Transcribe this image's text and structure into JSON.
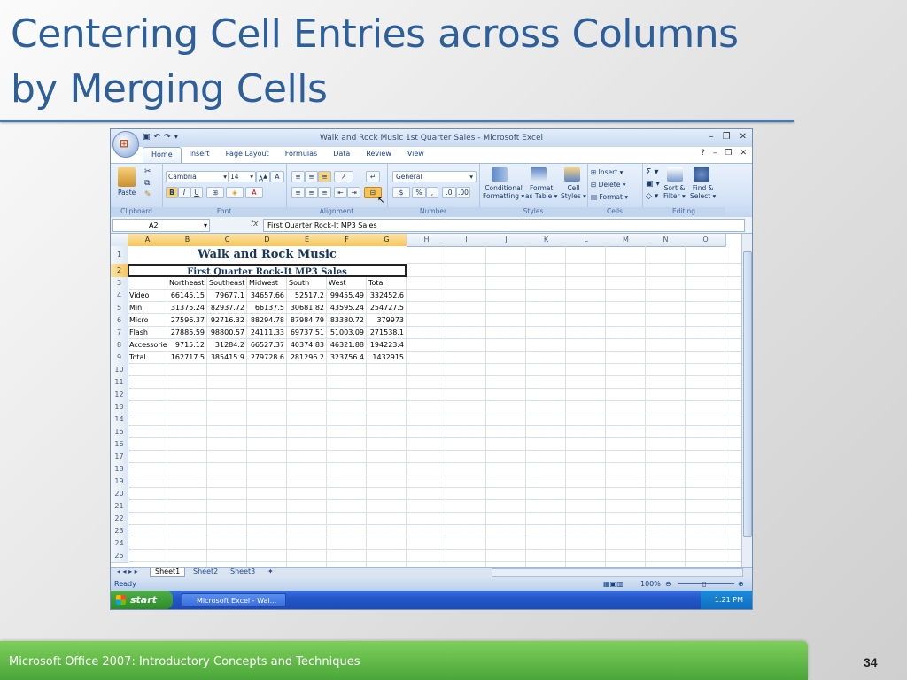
{
  "slide": {
    "title_line1": "Centering Cell Entries across Columns",
    "title_line2": "by Merging Cells",
    "footer_text": "Microsoft Office 2007: Introductory Concepts and Techniques",
    "page_number": "34"
  },
  "excel": {
    "window_title": "Walk and Rock Music 1st Quarter Sales - Microsoft Excel",
    "tabs": [
      "Home",
      "Insert",
      "Page Layout",
      "Formulas",
      "Data",
      "Review",
      "View"
    ],
    "ribbon": {
      "clipboard": {
        "label": "Clipboard",
        "paste": "Paste"
      },
      "font": {
        "label": "Font",
        "family": "Cambria",
        "size": "14"
      },
      "alignment": {
        "label": "Alignment"
      },
      "number": {
        "label": "Number",
        "format": "General",
        "currency": "$",
        "percent": "%",
        "comma": ","
      },
      "styles": {
        "label": "Styles",
        "conditional1": "Conditional",
        "conditional2": "Formatting",
        "format_table1": "Format",
        "format_table2": "as Table",
        "cell_styles1": "Cell",
        "cell_styles2": "Styles"
      },
      "cells": {
        "label": "Cells",
        "insert": "Insert",
        "delete": "Delete",
        "format": "Format"
      },
      "editing": {
        "label": "Editing",
        "sort1": "Sort &",
        "sort2": "Filter",
        "find1": "Find &",
        "find2": "Select"
      }
    },
    "name_box": "A2",
    "formula": "First Quarter Rock-It MP3 Sales",
    "columns": [
      "A",
      "B",
      "C",
      "D",
      "E",
      "F",
      "G",
      "H",
      "I",
      "J",
      "K",
      "L",
      "M",
      "N",
      "O"
    ],
    "rows": [
      "1",
      "2",
      "3",
      "4",
      "5",
      "6",
      "7",
      "8",
      "9",
      "10",
      "11",
      "12",
      "13",
      "14",
      "15",
      "16",
      "17",
      "18",
      "19",
      "20",
      "21",
      "22",
      "23",
      "24",
      "25"
    ],
    "title": "Walk and Rock Music",
    "subtitle": "First Quarter Rock-It MP3 Sales",
    "headers": [
      "",
      "Northeast",
      "Southeast",
      "Midwest",
      "South",
      "West",
      "Total"
    ],
    "data_rows": [
      [
        "Video",
        "66145.15",
        "79677.1",
        "34657.66",
        "52517.2",
        "99455.49",
        "332452.6"
      ],
      [
        "Mini",
        "31375.24",
        "82937.72",
        "66137.5",
        "30681.82",
        "43595.24",
        "254727.5"
      ],
      [
        "Micro",
        "27596.37",
        "92716.32",
        "88294.78",
        "87984.79",
        "83380.72",
        "379973"
      ],
      [
        "Flash",
        "27885.59",
        "98800.57",
        "24111.33",
        "69737.51",
        "51003.09",
        "271538.1"
      ],
      [
        "Accessorie",
        "9715.12",
        "31284.2",
        "66527.37",
        "40374.83",
        "46321.88",
        "194223.4"
      ],
      [
        "Total",
        "162717.5",
        "385415.9",
        "279728.6",
        "281296.2",
        "323756.4",
        "1432915"
      ]
    ],
    "sheets": [
      "Sheet1",
      "Sheet2",
      "Sheet3"
    ],
    "status": "Ready",
    "zoom": "100%",
    "taskbar": {
      "start": "start",
      "item": "Microsoft Excel - Wal...",
      "time": "1:21 PM"
    }
  }
}
